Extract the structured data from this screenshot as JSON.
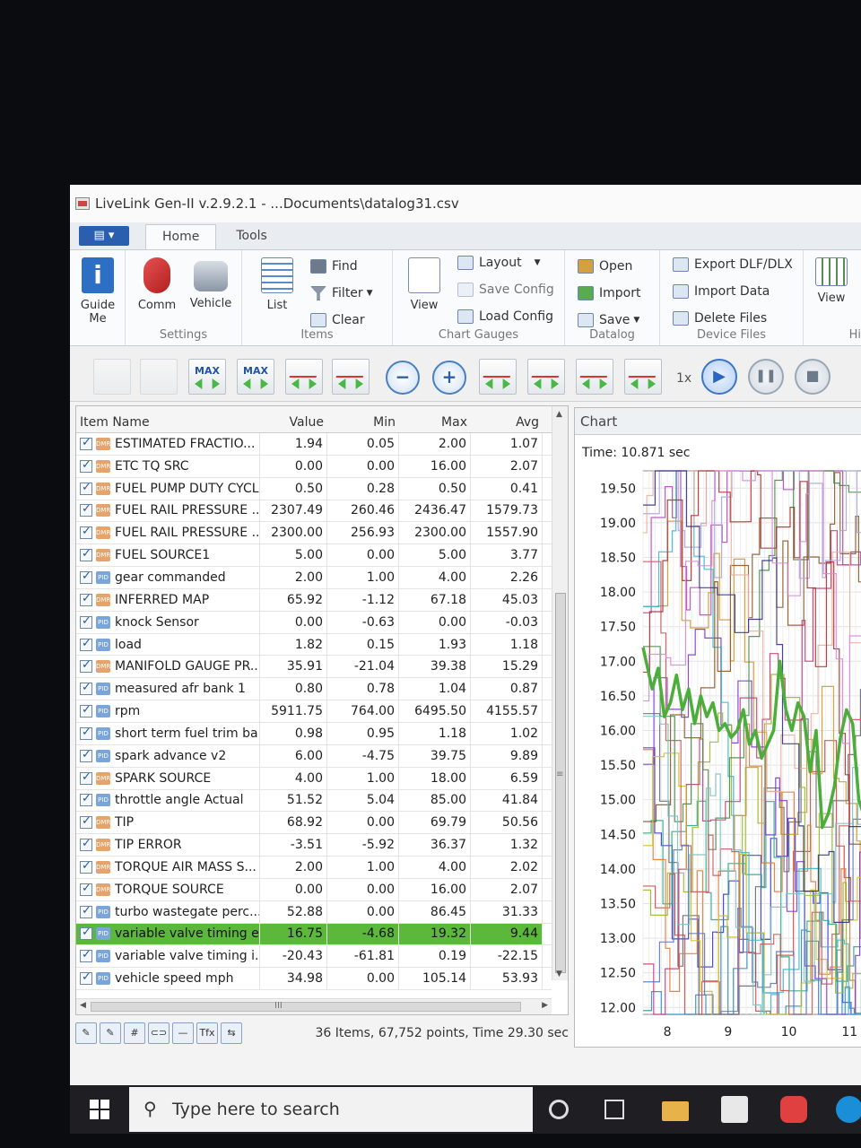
{
  "window": {
    "title": "LiveLink Gen-II  v.2.9.2.1 - ...Documents\\datalog31.csv"
  },
  "ribbon": {
    "app_menu": "▤ ▾",
    "tabs": [
      "Home",
      "Tools"
    ],
    "guide_me": "Guide Me",
    "comm": "Comm",
    "vehicle": "Vehicle",
    "settings_group": "Settings",
    "list": "List",
    "find": "Find",
    "filter": "Filter",
    "clear": "Clear",
    "items_group": "Items",
    "view": "View",
    "layout": "Layout",
    "save_config": "Save Config",
    "load_config": "Load Config",
    "chart_gauges_group": "Chart Gauges",
    "open": "Open",
    "import": "Import",
    "save": "Save",
    "datalog_group": "Datalog",
    "export": "Export DLF/DLX",
    "import_data": "Import Data",
    "delete_files": "Delete Files",
    "device_files_group": "Device Files",
    "view2": "View",
    "hi": "Hi"
  },
  "toolbar": {
    "max1": "MAX",
    "max2": "MAX",
    "zoom_out": "−",
    "zoom_in": "+",
    "speed": "1x",
    "play": "▶",
    "pause": "❚❚",
    "stop": "■"
  },
  "grid": {
    "headers": {
      "name": "Item Name",
      "value": "Value",
      "min": "Min",
      "max": "Max",
      "avg": "Avg"
    },
    "rows": [
      {
        "type": "DMR",
        "name": "ESTIMATED FRACTIO...",
        "value": "1.94",
        "min": "0.05",
        "max": "2.00",
        "avg": "1.07"
      },
      {
        "type": "DMR",
        "name": "ETC TQ SRC",
        "value": "0.00",
        "min": "0.00",
        "max": "16.00",
        "avg": "2.07"
      },
      {
        "type": "DMR",
        "name": "FUEL PUMP DUTY CYCLE",
        "value": "0.50",
        "min": "0.28",
        "max": "0.50",
        "avg": "0.41"
      },
      {
        "type": "DMR",
        "name": "FUEL RAIL PRESSURE ...",
        "value": "2307.49",
        "min": "260.46",
        "max": "2436.47",
        "avg": "1579.73"
      },
      {
        "type": "DMR",
        "name": "FUEL RAIL PRESSURE ...",
        "value": "2300.00",
        "min": "256.93",
        "max": "2300.00",
        "avg": "1557.90"
      },
      {
        "type": "DMR",
        "name": "FUEL SOURCE1",
        "value": "5.00",
        "min": "0.00",
        "max": "5.00",
        "avg": "3.77"
      },
      {
        "type": "PID",
        "name": "gear commanded",
        "value": "2.00",
        "min": "1.00",
        "max": "4.00",
        "avg": "2.26"
      },
      {
        "type": "DMR",
        "name": "INFERRED MAP",
        "value": "65.92",
        "min": "-1.12",
        "max": "67.18",
        "avg": "45.03"
      },
      {
        "type": "PID",
        "name": "knock Sensor",
        "value": "0.00",
        "min": "-0.63",
        "max": "0.00",
        "avg": "-0.03"
      },
      {
        "type": "PID",
        "name": "load",
        "value": "1.82",
        "min": "0.15",
        "max": "1.93",
        "avg": "1.18"
      },
      {
        "type": "DMR",
        "name": "MANIFOLD GAUGE PR...",
        "value": "35.91",
        "min": "-21.04",
        "max": "39.38",
        "avg": "15.29"
      },
      {
        "type": "PID",
        "name": "measured afr bank 1",
        "value": "0.80",
        "min": "0.78",
        "max": "1.04",
        "avg": "0.87"
      },
      {
        "type": "PID",
        "name": "rpm",
        "value": "5911.75",
        "min": "764.00",
        "max": "6495.50",
        "avg": "4155.57"
      },
      {
        "type": "PID",
        "name": "short term fuel trim ba...",
        "value": "0.98",
        "min": "0.95",
        "max": "1.18",
        "avg": "1.02"
      },
      {
        "type": "PID",
        "name": "spark advance v2",
        "value": "6.00",
        "min": "-4.75",
        "max": "39.75",
        "avg": "9.89"
      },
      {
        "type": "DMR",
        "name": "SPARK SOURCE",
        "value": "4.00",
        "min": "1.00",
        "max": "18.00",
        "avg": "6.59"
      },
      {
        "type": "PID",
        "name": "throttle angle Actual",
        "value": "51.52",
        "min": "5.04",
        "max": "85.00",
        "avg": "41.84"
      },
      {
        "type": "DMR",
        "name": "TIP",
        "value": "68.92",
        "min": "0.00",
        "max": "69.79",
        "avg": "50.56"
      },
      {
        "type": "DMR",
        "name": "TIP ERROR",
        "value": "-3.51",
        "min": "-5.92",
        "max": "36.37",
        "avg": "1.32"
      },
      {
        "type": "DMR",
        "name": "TORQUE AIR MASS S...",
        "value": "2.00",
        "min": "1.00",
        "max": "4.00",
        "avg": "2.02"
      },
      {
        "type": "DMR",
        "name": "TORQUE SOURCE",
        "value": "0.00",
        "min": "0.00",
        "max": "16.00",
        "avg": "2.07"
      },
      {
        "type": "PID",
        "name": "turbo wastegate perc...",
        "value": "52.88",
        "min": "0.00",
        "max": "86.45",
        "avg": "31.33"
      },
      {
        "type": "PID",
        "name": "variable valve timing e...",
        "value": "16.75",
        "min": "-4.68",
        "max": "19.32",
        "avg": "9.44",
        "selected": true
      },
      {
        "type": "PID",
        "name": "variable valve timing i...",
        "value": "-20.43",
        "min": "-61.81",
        "max": "0.19",
        "avg": "-22.15"
      },
      {
        "type": "PID",
        "name": "vehicle speed mph",
        "value": "34.98",
        "min": "0.00",
        "max": "105.14",
        "avg": "53.93"
      }
    ],
    "hscroll_grip": "III",
    "vscroll_grip": "≡"
  },
  "status": {
    "buttons": [
      "✎",
      "✎",
      "#",
      "⊂⊃",
      "—",
      "Tfx",
      "⇆"
    ],
    "text": "36 Items, 67,752 points, Time 29.30 sec"
  },
  "chart": {
    "header": "Chart",
    "time": "Time: 10.871 sec",
    "highlight_color": "#4cae3a"
  },
  "chart_data": {
    "type": "line",
    "title": "",
    "xlabel": "",
    "ylabel": "",
    "x_ticks": [
      "8",
      "9",
      "10",
      "11"
    ],
    "y_ticks": [
      "12.00",
      "12.50",
      "13.00",
      "13.50",
      "14.00",
      "14.50",
      "15.00",
      "15.50",
      "16.00",
      "16.50",
      "17.00",
      "17.50",
      "18.00",
      "18.50",
      "19.00",
      "19.50"
    ],
    "xlim": [
      7.6,
      11.35
    ],
    "ylim": [
      11.9,
      19.75
    ],
    "grid": true,
    "highlight_series": {
      "x": [
        7.6,
        7.75,
        7.85,
        7.95,
        8.05,
        8.15,
        8.25,
        8.35,
        8.45,
        8.55,
        8.65,
        8.75,
        8.85,
        8.95,
        9.05,
        9.15,
        9.25,
        9.35,
        9.45,
        9.55,
        9.65,
        9.75,
        9.85,
        9.95,
        10.05,
        10.15,
        10.25,
        10.35,
        10.45,
        10.55,
        10.65,
        10.75,
        10.85,
        10.95,
        11.05,
        11.15,
        11.3
      ],
      "y": [
        17.2,
        16.6,
        16.9,
        16.2,
        16.4,
        16.8,
        16.3,
        16.6,
        16.1,
        16.5,
        16.2,
        16.4,
        16.0,
        16.1,
        15.9,
        16.0,
        16.3,
        15.8,
        16.0,
        15.6,
        15.8,
        16.0,
        17.0,
        16.3,
        16.0,
        16.4,
        16.2,
        15.4,
        16.0,
        14.6,
        14.8,
        15.2,
        15.9,
        16.3,
        16.1,
        15.0,
        14.6
      ]
    },
    "other_series_count": 23,
    "other_series_colors": [
      "#3a3ad0",
      "#d04a4a",
      "#2d8fc8",
      "#b84ab8",
      "#d09a2a",
      "#6a6a6a",
      "#2aa88a",
      "#e07a3a",
      "#7a3ad0",
      "#9ab82a",
      "#c83a7a",
      "#3ab8d0",
      "#8a5a2a",
      "#d0c02a",
      "#4a8a4a",
      "#c85a5a",
      "#5a7ab8",
      "#a8a8d8",
      "#e8b0a0",
      "#80c0c0",
      "#b03030",
      "#303090",
      "#d88ad8"
    ]
  },
  "taskbar": {
    "search_placeholder": "Type here to search",
    "search_icon": "⚲"
  }
}
